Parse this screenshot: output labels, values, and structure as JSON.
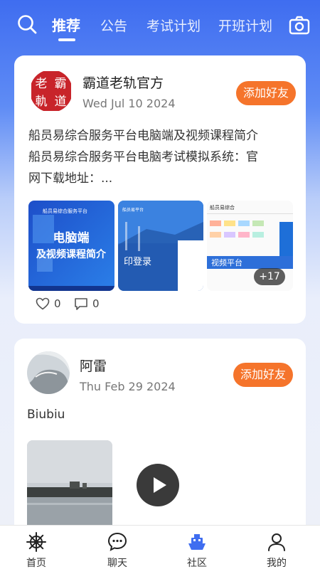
{
  "header": {
    "tabs": [
      {
        "label": "推荐",
        "active": true
      },
      {
        "label": "公告",
        "active": false
      },
      {
        "label": "考试计划",
        "active": false
      },
      {
        "label": "开班计划",
        "active": false
      }
    ],
    "search_icon": "search-icon",
    "camera_icon": "camera-icon"
  },
  "posts": [
    {
      "author": "霸道老轨官方",
      "avatar_text": [
        "老",
        "霸",
        "軌",
        "道"
      ],
      "date": "Wed Jul 10 2024",
      "add_friend_label": "添加好友",
      "text_lines": [
        "船员易综合服务平台电脑端及视频课程简介",
        "船员易综合服务平台电脑考试模拟系统：官",
        "网下载地址：..."
      ],
      "images": [
        {
          "caption_top": "船员易综合服务平台",
          "caption_main_1": "电脑端",
          "caption_main_2": "及视频课程简介"
        },
        {
          "caption_small": "船员易平台",
          "caption_main": "印登录"
        },
        {
          "caption_top": "船员易综合",
          "caption_sub": "视频平台"
        }
      ],
      "more_count": "+17",
      "likes": "0",
      "comments": "0"
    },
    {
      "author": "阿雷",
      "date": "Thu Feb 29 2024",
      "add_friend_label": "添加好友",
      "text_lines": [
        "Biubiu"
      ],
      "has_video": true
    }
  ],
  "bottom_nav": [
    {
      "label": "首页",
      "icon": "ship-wheel-icon",
      "active": false
    },
    {
      "label": "聊天",
      "icon": "chat-bubble-icon",
      "active": false
    },
    {
      "label": "社区",
      "icon": "ship-icon",
      "active": true
    },
    {
      "label": "我的",
      "icon": "person-icon",
      "active": false
    }
  ],
  "colors": {
    "accent_orange": "#f5742b",
    "header_blue": "#3f6df0",
    "nav_active_blue": "#3f6df0"
  }
}
